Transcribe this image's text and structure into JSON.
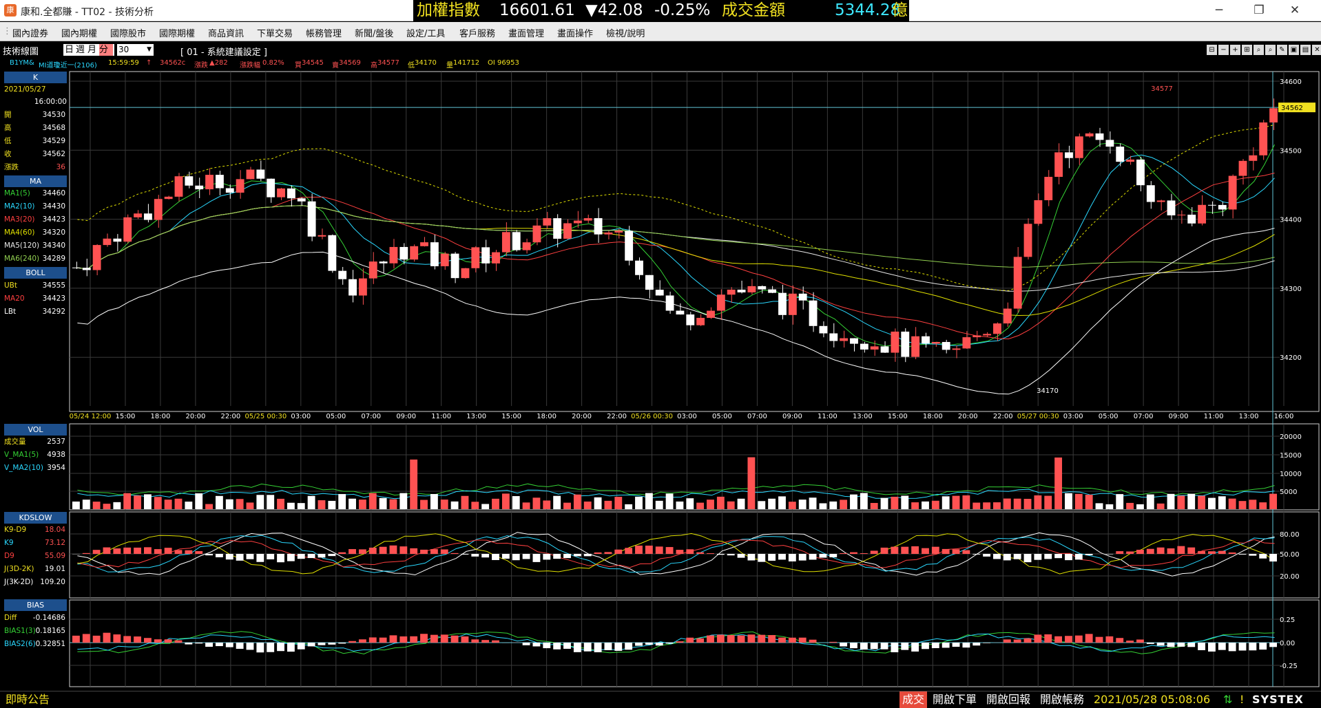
{
  "window": {
    "title": "康和.全都賺 - TT02 - 技術分析",
    "logo": "康"
  },
  "ticker": {
    "name": "加權指數",
    "index": "16601.61",
    "change": "▼42.08",
    "pct": "-0.25%",
    "turnover_label": "成交金額",
    "turnover": "5344.28",
    "unit": "億"
  },
  "menu": [
    "國內證券",
    "國內期權",
    "國際股市",
    "國際期權",
    "商品資訊",
    "下單交易",
    "帳務管理",
    "新聞/盤後",
    "設定/工具",
    "客戶服務",
    "畫面管理",
    "畫面操作",
    "檢視/說明"
  ],
  "toolbar": {
    "title": "技術線圖",
    "periods": [
      "日",
      "週",
      "月",
      "分"
    ],
    "selected_period": "分",
    "interval": "30",
    "setting": "[ 01 - 系統建議設定 ]"
  },
  "quote": {
    "symbol": "B1YM&",
    "name": "MI道瓊近一(2106)",
    "time": "15:59:59",
    "last": "34562c",
    "change_label": "漲跌",
    "change": "▲282",
    "pct_label": "漲跌幅",
    "pct": "0.82%",
    "buy_label": "買",
    "buy": "34545",
    "sell_label": "賣",
    "sell": "34569",
    "high_label": "高",
    "high": "34577",
    "low_label": "低",
    "low": "34170",
    "vol_label": "量",
    "vol": "141712",
    "oi_label": "OI",
    "oi": "96953"
  },
  "colors": {
    "up": "#ff5252",
    "down": "#ffffff",
    "ma1": "#35d235",
    "ma2": "#2ad8ff",
    "ma3": "#ff4040",
    "ma4": "#e0e000",
    "ma5": "#e8e8e8",
    "ma6": "#92d050",
    "accent": "#1d4f8c"
  },
  "panels": {
    "k": {
      "title": "K",
      "date": "2021/05/27",
      "time": "16:00:00",
      "rows": [
        {
          "k": "開",
          "v": "34530"
        },
        {
          "k": "高",
          "v": "34568"
        },
        {
          "k": "低",
          "v": "34529"
        },
        {
          "k": "收",
          "v": "34562"
        },
        {
          "k": "漲跌",
          "v": "36"
        }
      ]
    },
    "ma": {
      "title": "MA",
      "rows": [
        {
          "k": "MA1(5)",
          "v": "34460"
        },
        {
          "k": "MA2(10)",
          "v": "34430"
        },
        {
          "k": "MA3(20)",
          "v": "34423"
        },
        {
          "k": "MA4(60)",
          "v": "34320"
        },
        {
          "k": "MA5(120)",
          "v": "34340"
        },
        {
          "k": "MA6(240)",
          "v": "34289"
        }
      ]
    },
    "boll": {
      "title": "BOLL",
      "rows": [
        {
          "k": "UBt",
          "v": "34555"
        },
        {
          "k": "MA20",
          "v": "34423"
        },
        {
          "k": "LBt",
          "v": "34292"
        }
      ]
    },
    "vol": {
      "title": "VOL",
      "rows": [
        {
          "k": "成交量",
          "v": "2537"
        },
        {
          "k": "V_MA1(5)",
          "v": "4938"
        },
        {
          "k": "V_MA2(10)",
          "v": "3954"
        }
      ]
    },
    "kd": {
      "title": "KDSLOW",
      "rows": [
        {
          "k": "K9-D9",
          "v": "18.04"
        },
        {
          "k": "K9",
          "v": "73.12"
        },
        {
          "k": "D9",
          "v": "55.09"
        },
        {
          "k": "J(3D-2K)",
          "v": "19.01"
        },
        {
          "k": "J(3K-2D)",
          "v": "109.20"
        }
      ]
    },
    "bias": {
      "title": "BIAS",
      "rows": [
        {
          "k": "Diff",
          "v": "-0.14686"
        },
        {
          "k": "BIAS1(3)",
          "v": "0.18165"
        },
        {
          "k": "BIAS2(6)",
          "v": "0.32851"
        }
      ]
    }
  },
  "chart_data": {
    "type": "candlestick",
    "price_ticks": [
      "34600",
      "34500",
      "34400",
      "34300",
      "34200"
    ],
    "last_price_label": "34562",
    "annotations": {
      "high": "34577",
      "low": "34170"
    },
    "x_ticks": [
      "05/24 12:00",
      "15:00",
      "18:00",
      "20:00",
      "22:00",
      "05/25 00:30",
      "03:00",
      "05:00",
      "07:00",
      "09:00",
      "11:00",
      "13:00",
      "15:00",
      "18:00",
      "20:00",
      "22:00",
      "05/26 00:30",
      "03:00",
      "05:00",
      "07:00",
      "09:00",
      "11:00",
      "13:00",
      "15:00",
      "18:00",
      "20:00",
      "22:00",
      "05/27 00:30",
      "03:00",
      "05:00",
      "07:00",
      "09:00",
      "11:00",
      "13:00",
      "16:00"
    ],
    "vol_ticks": [
      "20000",
      "15000",
      "10000",
      "5000"
    ],
    "kd_ticks": [
      "80.00",
      "50.00",
      "20.00"
    ],
    "bias_ticks": [
      "0.25",
      "0.00",
      "-0.25"
    ]
  },
  "status": {
    "left": "即時公告",
    "btn1": "成交",
    "btn2": "開啟下單",
    "btn3": "開啟回報",
    "btn4": "開啟帳務",
    "datetime": "2021/05/28 05:08:06",
    "brand": "SYSTEX"
  }
}
